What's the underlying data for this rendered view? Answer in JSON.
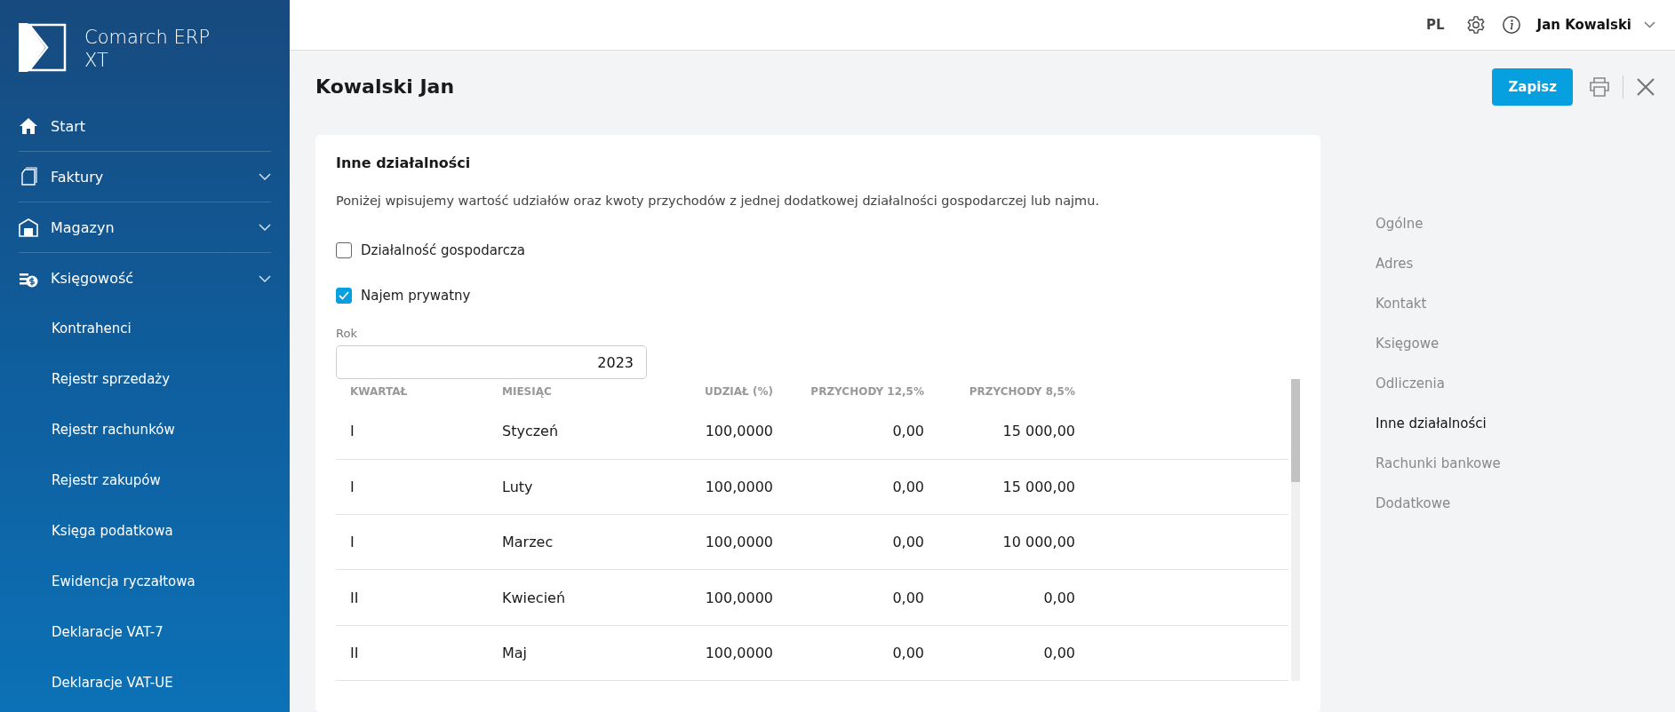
{
  "sidebar": {
    "logo_text": "Comarch ERP XT",
    "items": [
      {
        "label": "Start",
        "kind": "link"
      },
      {
        "label": "Faktury",
        "kind": "group"
      },
      {
        "label": "Magazyn",
        "kind": "group"
      },
      {
        "label": "Księgowość",
        "kind": "group",
        "children": [
          {
            "label": "Kontrahenci"
          },
          {
            "label": "Rejestr sprzedaży"
          },
          {
            "label": "Rejestr rachunków"
          },
          {
            "label": "Rejestr zakupów"
          },
          {
            "label": "Księga podatkowa"
          },
          {
            "label": "Ewidencja ryczałtowa"
          },
          {
            "label": "Deklaracje VAT-7"
          },
          {
            "label": "Deklaracje VAT-UE"
          }
        ]
      }
    ]
  },
  "topbar": {
    "language": "PL",
    "user": "Jan Kowalski"
  },
  "header": {
    "title": "Kowalski Jan",
    "save_button": "Zapisz"
  },
  "card": {
    "title": "Inne działalności",
    "description": "Poniżej wpisujemy wartość udziałów oraz kwoty przychodów z jednej dodatkowej działalności gospodarczej lub najmu.",
    "checkboxes": [
      {
        "label": "Działalność gospodarcza",
        "checked": false
      },
      {
        "label": "Najem prywatny",
        "checked": true
      }
    ],
    "year_field": {
      "label": "Rok",
      "value": "2023"
    },
    "table": {
      "columns": [
        "KWARTAŁ",
        "MIESIĄC",
        "UDZIAŁ (%)",
        "PRZYCHODY 12,5%",
        "PRZYCHODY 8,5%"
      ],
      "rows": [
        [
          "I",
          "Styczeń",
          "100,0000",
          "0,00",
          "15 000,00"
        ],
        [
          "I",
          "Luty",
          "100,0000",
          "0,00",
          "15 000,00"
        ],
        [
          "I",
          "Marzec",
          "100,0000",
          "0,00",
          "10 000,00"
        ],
        [
          "II",
          "Kwiecień",
          "100,0000",
          "0,00",
          "0,00"
        ],
        [
          "II",
          "Maj",
          "100,0000",
          "0,00",
          "0,00"
        ]
      ]
    }
  },
  "section_nav": [
    {
      "label": "Ogólne",
      "selected": false
    },
    {
      "label": "Adres",
      "selected": false
    },
    {
      "label": "Kontakt",
      "selected": false
    },
    {
      "label": "Księgowe",
      "selected": false
    },
    {
      "label": "Odliczenia",
      "selected": false
    },
    {
      "label": "Inne działalności",
      "selected": true
    },
    {
      "label": "Rachunki bankowe",
      "selected": false
    },
    {
      "label": "Dodatkowe",
      "selected": false
    }
  ]
}
